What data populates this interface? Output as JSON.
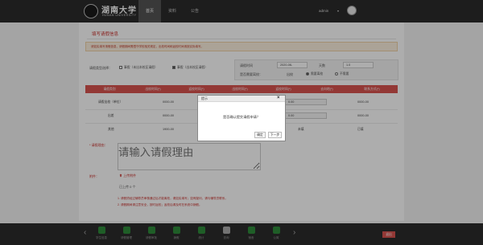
{
  "header": {
    "logo_text": "湖南大学",
    "logo_sub": "HUNAN UNIVERSITY",
    "nav": [
      {
        "label": "首页"
      },
      {
        "label": "资料"
      },
      {
        "label": "公告"
      }
    ],
    "user_name": "admin"
  },
  "form": {
    "title": "填写请假信息",
    "alert": "请如实填写请假信息，请假期间需遵守学校相关规定，出校时间和返校时间请按实际填写。",
    "leave_type_label": "请假类型选择：",
    "leave_type_options": [
      {
        "label": "事假（未出本校区请假）",
        "checked": false
      },
      {
        "label": "事假（出本校区请假）",
        "checked": true
      }
    ],
    "leave_date_label": "请假时间",
    "leave_date_value": "2020-06-",
    "days_label": "天数",
    "days_value": "1.0",
    "need_leave_label": "是否需要离校：",
    "need_leave_value": "出校",
    "radio_options": [
      {
        "label": "需要离校",
        "checked": true
      },
      {
        "label": "不需要",
        "checked": false
      }
    ]
  },
  "table": {
    "headers": [
      "请假类别",
      "出校时间(*)",
      "返校时间(*)",
      "出校时间(*)",
      "返校时间(*)",
      "去向地(*)",
      "联系方式(*)"
    ],
    "rows": [
      {
        "label": "请假出校（单位）",
        "v1": "0000-00",
        "v2": "0.00",
        "v3": "0000-00"
      },
      {
        "label": "出差",
        "v1": "0000-00",
        "v2": "0.00",
        "v3": "0000-00"
      },
      {
        "label": "其他",
        "v1": "1900-00",
        "v2": "未填",
        "v3": "已填"
      }
    ]
  },
  "remark": {
    "label": "* 请假理由：",
    "placeholder": "请输入请假理由"
  },
  "attach": {
    "label": "附件：",
    "upload_label": "上传附件",
    "file_count": "已上传 0 个"
  },
  "notes": [
    "1. 请假须经过辅导员审核通过后才能离校，请如实填写；如有疑问，请与辅导员联系。",
    "2. 请假期间请注意安全，按时返校；返校后请及时在系统中销假。"
  ],
  "modal": {
    "title": "提示",
    "message": "是否确认提交请假申请？",
    "confirm": "确定",
    "next": "下一步"
  },
  "dock": {
    "items": [
      {
        "label": "学生信息",
        "icon": "student-icon",
        "color": "#2e8b3a"
      },
      {
        "label": "请假管理",
        "icon": "leave-icon",
        "color": "#2e8b3a"
      },
      {
        "label": "请假审批",
        "icon": "approve-icon",
        "color": "#2e8b3a"
      },
      {
        "label": "销假",
        "icon": "cart-icon",
        "color": "#2e8b3a"
      },
      {
        "label": "统计",
        "icon": "camera-icon",
        "color": "#2e8b3a"
      },
      {
        "label": "查询",
        "icon": "road-icon",
        "color": "#aaaaaa"
      },
      {
        "label": "宿舍",
        "icon": "bed-icon",
        "color": "#2e8b3a"
      },
      {
        "label": "公寓",
        "icon": "bed2-icon",
        "color": "#2e8b3a"
      }
    ],
    "exit_label": "退出"
  }
}
